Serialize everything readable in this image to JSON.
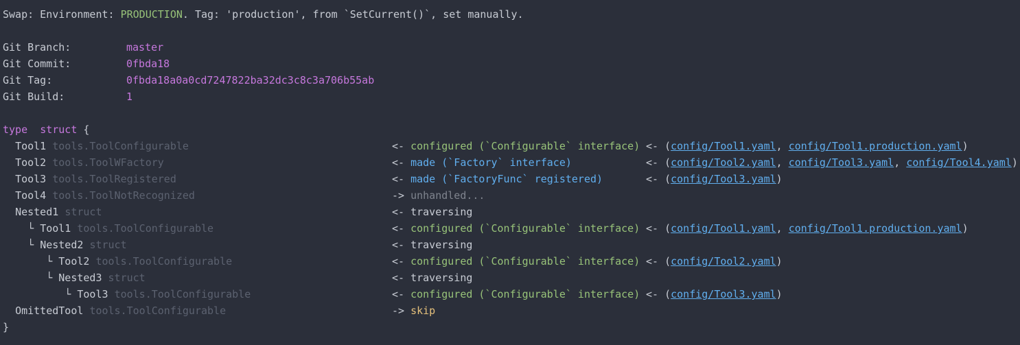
{
  "swap": {
    "prefix": "Swap: Environment: ",
    "env": "PRODUCTION",
    "suffix": ". Tag: 'production', from `SetCurrent()`, set manually."
  },
  "git": [
    {
      "label": "Git Branch:",
      "value": "master"
    },
    {
      "label": "Git Commit:",
      "value": "0fbda18"
    },
    {
      "label": "Git Tag:",
      "value": "0fbda18a0a0cd7247822ba32dc3c8c3a706b55ab"
    },
    {
      "label": "Git Build:",
      "value": "1"
    }
  ],
  "struct": {
    "kw_type": "type",
    "kw_struct": "struct",
    "open": "{",
    "close": "}",
    "rows": [
      {
        "tree": "",
        "name": "Tool1",
        "type": "tools.ToolConfigurable",
        "arrow": "<-",
        "status": "configured (`Configurable` interface)",
        "status_class": "grn",
        "files": [
          "config/Tool1.yaml",
          "config/Tool1.production.yaml"
        ]
      },
      {
        "tree": "",
        "name": "Tool2",
        "type": "tools.ToolWFactory",
        "arrow": "<-",
        "status": "made (`Factory` interface)",
        "status_class": "blu",
        "files": [
          "config/Tool2.yaml",
          "config/Tool3.yaml",
          "config/Tool4.yaml"
        ]
      },
      {
        "tree": "",
        "name": "Tool3",
        "type": "tools.ToolRegistered",
        "arrow": "<-",
        "status": "made (`FactoryFunc` registered)",
        "status_class": "blu",
        "files": [
          "config/Tool3.yaml"
        ]
      },
      {
        "tree": "",
        "name": "Tool4",
        "type": "tools.ToolNotRecognized",
        "arrow": "->",
        "status": "unhandled...",
        "status_class": "gry",
        "files": []
      },
      {
        "tree": "",
        "name": "Nested1",
        "type": "struct",
        "arrow": "<-",
        "status": "traversing",
        "status_class": "",
        "files": []
      },
      {
        "tree": "  └ ",
        "name": "Tool1",
        "type": "tools.ToolConfigurable",
        "arrow": "<-",
        "status": "configured (`Configurable` interface)",
        "status_class": "grn",
        "files": [
          "config/Tool1.yaml",
          "config/Tool1.production.yaml"
        ]
      },
      {
        "tree": "  └ ",
        "name": "Nested2",
        "type": "struct",
        "arrow": "<-",
        "status": "traversing",
        "status_class": "",
        "files": []
      },
      {
        "tree": "     └ ",
        "name": "Tool2",
        "type": "tools.ToolConfigurable",
        "arrow": "<-",
        "status": "configured (`Configurable` interface)",
        "status_class": "grn",
        "files": [
          "config/Tool2.yaml"
        ]
      },
      {
        "tree": "     └ ",
        "name": "Nested3",
        "type": "struct",
        "arrow": "<-",
        "status": "traversing",
        "status_class": "",
        "files": []
      },
      {
        "tree": "        └ ",
        "name": "Tool3",
        "type": "tools.ToolConfigurable",
        "arrow": "<-",
        "status": "configured (`Configurable` interface)",
        "status_class": "grn",
        "files": [
          "config/Tool3.yaml"
        ]
      },
      {
        "tree": "",
        "name": "OmittedTool",
        "type": "tools.ToolConfigurable",
        "arrow": "->",
        "status": "skip",
        "status_class": "org",
        "files": []
      }
    ]
  }
}
